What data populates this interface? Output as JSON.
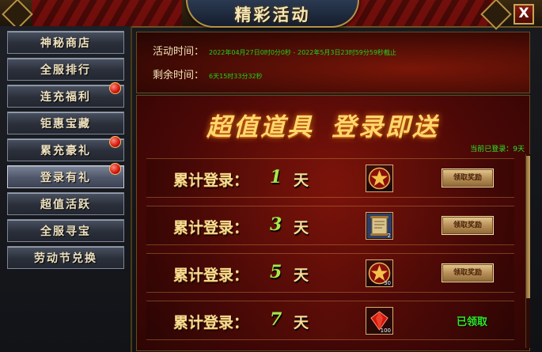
{
  "window": {
    "title": "精彩活动",
    "close_label": "X"
  },
  "sidebar": {
    "items": [
      {
        "label": "神秘商店",
        "badge": false,
        "active": false
      },
      {
        "label": "全服排行",
        "badge": false,
        "active": false
      },
      {
        "label": "连充福利",
        "badge": true,
        "active": false
      },
      {
        "label": "钜惠宝藏",
        "badge": false,
        "active": false
      },
      {
        "label": "累充豪礼",
        "badge": true,
        "active": false
      },
      {
        "label": "登录有礼",
        "badge": true,
        "active": true
      },
      {
        "label": "超值活跃",
        "badge": false,
        "active": false
      },
      {
        "label": "全服寻宝",
        "badge": false,
        "active": false
      },
      {
        "label": "劳动节兑换",
        "badge": false,
        "active": false
      }
    ]
  },
  "info": {
    "time_label": "活动时间：",
    "time_value": "2022年04月27日0时0分0秒 - 2022年5月3日23时59分59秒截止",
    "remaining_label": "剩余时间：",
    "remaining_value": "6天15时33分32秒"
  },
  "main": {
    "banner_left": "超值道具",
    "banner_right": "登录即送",
    "login_count": "当前已登录：9天",
    "rows": [
      {
        "label": "累计登录：",
        "days": "1",
        "unit": "天",
        "icon": "red-star-emblem-icon",
        "qty": "",
        "action": "领取奖励",
        "claimed": false
      },
      {
        "label": "累计登录：",
        "days": "3",
        "unit": "天",
        "icon": "scroll-item-icon",
        "qty": "2",
        "action": "领取奖励",
        "claimed": false
      },
      {
        "label": "累计登录：",
        "days": "5",
        "unit": "天",
        "icon": "red-star-emblem-icon",
        "qty": "30",
        "action": "领取奖励",
        "claimed": false
      },
      {
        "label": "累计登录：",
        "days": "7",
        "unit": "天",
        "icon": "red-gem-icon",
        "qty": "100",
        "action": "已领取",
        "claimed": true
      }
    ]
  },
  "colors": {
    "highlight_green": "#2ee82a",
    "gold_text": "#f6dd95",
    "panel_red": "#7d130a"
  }
}
